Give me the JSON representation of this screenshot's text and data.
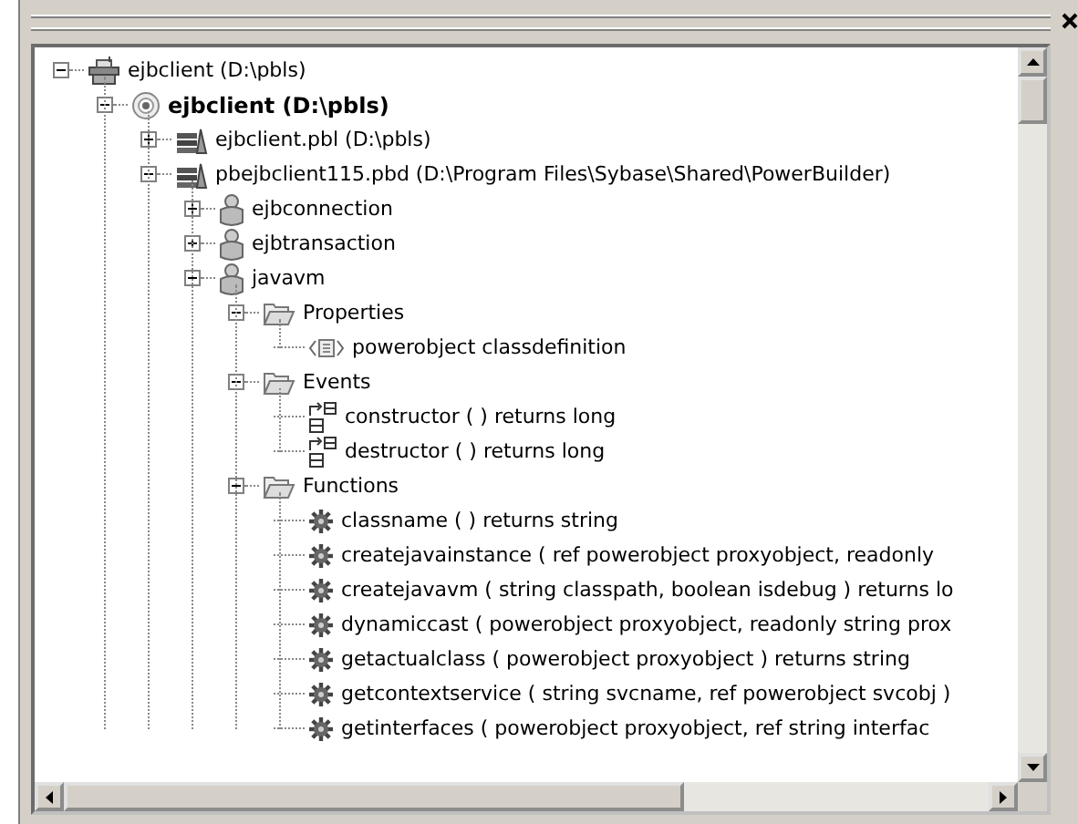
{
  "tree": [
    {
      "kind": "workspace",
      "label": "ejbclient (D:\\pbls)",
      "expanded": true,
      "children": [
        {
          "kind": "target",
          "label": "ejbclient (D:\\pbls)",
          "expanded": true,
          "children": [
            {
              "kind": "library",
              "label": "ejbclient.pbl (D:\\pbls)",
              "expanded": false
            },
            {
              "kind": "library",
              "label": "pbejbclient115.pbd (D:\\Program Files\\Sybase\\Shared\\PowerBuilder)",
              "expanded": true,
              "children": [
                {
                  "kind": "object",
                  "label": "ejbconnection",
                  "expanded": false
                },
                {
                  "kind": "object",
                  "label": "ejbtransaction",
                  "expanded": false
                },
                {
                  "kind": "object",
                  "label": "javavm",
                  "expanded": true,
                  "children": [
                    {
                      "kind": "folder",
                      "label": "Properties",
                      "expanded": true,
                      "children": [
                        {
                          "kind": "property",
                          "label": "powerobject classdefinition"
                        }
                      ]
                    },
                    {
                      "kind": "folder",
                      "label": "Events",
                      "expanded": true,
                      "children": [
                        {
                          "kind": "event",
                          "label": "constructor ( )  returns long"
                        },
                        {
                          "kind": "event",
                          "label": "destructor ( )  returns long"
                        }
                      ]
                    },
                    {
                      "kind": "folder",
                      "label": "Functions",
                      "expanded": true,
                      "children": [
                        {
                          "kind": "function",
                          "label": "classname ( )  returns string"
                        },
                        {
                          "kind": "function",
                          "label": "createjavainstance ( ref powerobject proxyobject, readonly"
                        },
                        {
                          "kind": "function",
                          "label": "createjavavm ( string classpath, boolean isdebug )  returns lo"
                        },
                        {
                          "kind": "function",
                          "label": "dynamiccast ( powerobject proxyobject, readonly string prox"
                        },
                        {
                          "kind": "function",
                          "label": "getactualclass ( powerobject proxyobject )  returns string"
                        },
                        {
                          "kind": "function",
                          "label": "getcontextservice ( string svcname, ref powerobject svcobj )"
                        },
                        {
                          "kind": "function",
                          "label": "getinterfaces ( powerobject proxyobject, ref string interfac"
                        }
                      ]
                    }
                  ]
                }
              ]
            }
          ]
        }
      ]
    }
  ]
}
